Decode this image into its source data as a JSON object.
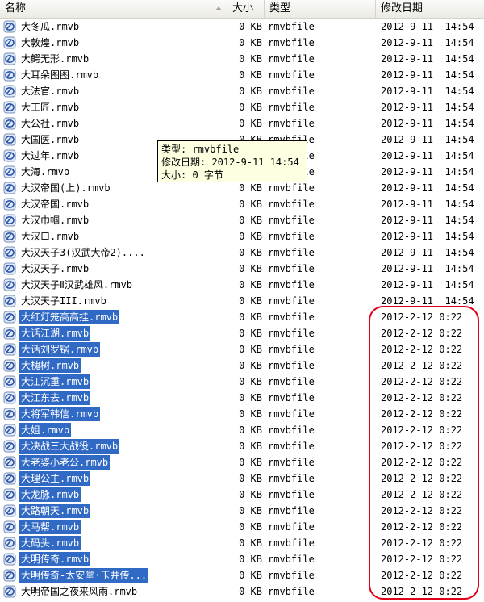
{
  "columns": {
    "name": "名称",
    "size": "大小",
    "type": "类型",
    "date": "修改日期"
  },
  "files": [
    {
      "name": "大冬瓜.rmvb",
      "size": "0 KB",
      "type": "rmvbfile",
      "date": "2012-9-11  14:54",
      "selected": false
    },
    {
      "name": "大敦煌.rmvb",
      "size": "0 KB",
      "type": "rmvbfile",
      "date": "2012-9-11  14:54",
      "selected": false
    },
    {
      "name": "大鳄无形.rmvb",
      "size": "0 KB",
      "type": "rmvbfile",
      "date": "2012-9-11  14:54",
      "selected": false
    },
    {
      "name": "大耳朵图图.rmvb",
      "size": "0 KB",
      "type": "rmvbfile",
      "date": "2012-9-11  14:54",
      "selected": false
    },
    {
      "name": "大法官.rmvb",
      "size": "0 KB",
      "type": "rmvbfile",
      "date": "2012-9-11  14:54",
      "selected": false
    },
    {
      "name": "大工匠.rmvb",
      "size": "0 KB",
      "type": "rmvbfile",
      "date": "2012-9-11  14:54",
      "selected": false
    },
    {
      "name": "大公社.rmvb",
      "size": "0 KB",
      "type": "rmvbfile",
      "date": "2012-9-11  14:54",
      "selected": false
    },
    {
      "name": "大国医.rmvb",
      "size": "0 KB",
      "type": "rmvbfile",
      "date": "2012-9-11  14:54",
      "selected": false
    },
    {
      "name": "大过年.rmvb",
      "size": "0 KB",
      "type": "rmvbfile",
      "date": "2012-9-11  14:54",
      "selected": false
    },
    {
      "name": "大海.rmvb",
      "size": "0 KB",
      "type": "rmvbfile",
      "date": "2012-9-11  14:54",
      "selected": false
    },
    {
      "name": "大汉帝国(上).rmvb",
      "size": "0 KB",
      "type": "rmvbfile",
      "date": "2012-9-11  14:54",
      "selected": false
    },
    {
      "name": "大汉帝国.rmvb",
      "size": "0 KB",
      "type": "rmvbfile",
      "date": "2012-9-11  14:54",
      "selected": false
    },
    {
      "name": "大汉巾帼.rmvb",
      "size": "0 KB",
      "type": "rmvbfile",
      "date": "2012-9-11  14:54",
      "selected": false
    },
    {
      "name": "大汉口.rmvb",
      "size": "0 KB",
      "type": "rmvbfile",
      "date": "2012-9-11  14:54",
      "selected": false
    },
    {
      "name": "大汉天子3(汉武大帝2)....",
      "size": "0 KB",
      "type": "rmvbfile",
      "date": "2012-9-11  14:54",
      "selected": false
    },
    {
      "name": "大汉天子.rmvb",
      "size": "0 KB",
      "type": "rmvbfile",
      "date": "2012-9-11  14:54",
      "selected": false
    },
    {
      "name": "大汉天子Ⅱ汉武雄风.rmvb",
      "size": "0 KB",
      "type": "rmvbfile",
      "date": "2012-9-11  14:54",
      "selected": false
    },
    {
      "name": "大汉天子III.rmvb",
      "size": "0 KB",
      "type": "rmvbfile",
      "date": "2012-9-11  14:54",
      "selected": false
    },
    {
      "name": "大红灯笼高高挂.rmvb",
      "size": "0 KB",
      "type": "rmvbfile",
      "date": "2012-2-12 0:22",
      "selected": true
    },
    {
      "name": "大话江湖.rmvb",
      "size": "0 KB",
      "type": "rmvbfile",
      "date": "2012-2-12 0:22",
      "selected": true
    },
    {
      "name": "大话刘罗锅.rmvb",
      "size": "0 KB",
      "type": "rmvbfile",
      "date": "2012-2-12 0:22",
      "selected": true
    },
    {
      "name": "大槐树.rmvb",
      "size": "0 KB",
      "type": "rmvbfile",
      "date": "2012-2-12 0:22",
      "selected": true
    },
    {
      "name": "大江沉重.rmvb",
      "size": "0 KB",
      "type": "rmvbfile",
      "date": "2012-2-12 0:22",
      "selected": true
    },
    {
      "name": "大江东去.rmvb",
      "size": "0 KB",
      "type": "rmvbfile",
      "date": "2012-2-12 0:22",
      "selected": true
    },
    {
      "name": "大将军韩信.rmvb",
      "size": "0 KB",
      "type": "rmvbfile",
      "date": "2012-2-12 0:22",
      "selected": true
    },
    {
      "name": "大姐.rmvb",
      "size": "0 KB",
      "type": "rmvbfile",
      "date": "2012-2-12 0:22",
      "selected": true
    },
    {
      "name": "大决战三大战役.rmvb",
      "size": "0 KB",
      "type": "rmvbfile",
      "date": "2012-2-12 0:22",
      "selected": true
    },
    {
      "name": "大老婆小老公.rmvb",
      "size": "0 KB",
      "type": "rmvbfile",
      "date": "2012-2-12 0:22",
      "selected": true
    },
    {
      "name": "大理公主.rmvb",
      "size": "0 KB",
      "type": "rmvbfile",
      "date": "2012-2-12 0:22",
      "selected": true
    },
    {
      "name": "大龙脉.rmvb",
      "size": "0 KB",
      "type": "rmvbfile",
      "date": "2012-2-12 0:22",
      "selected": true
    },
    {
      "name": "大路朝天.rmvb",
      "size": "0 KB",
      "type": "rmvbfile",
      "date": "2012-2-12 0:22",
      "selected": true
    },
    {
      "name": "大马帮.rmvb",
      "size": "0 KB",
      "type": "rmvbfile",
      "date": "2012-2-12 0:22",
      "selected": true
    },
    {
      "name": "大码头.rmvb",
      "size": "0 KB",
      "type": "rmvbfile",
      "date": "2012-2-12 0:22",
      "selected": true
    },
    {
      "name": "大明传奇.rmvb",
      "size": "0 KB",
      "type": "rmvbfile",
      "date": "2012-2-12 0:22",
      "selected": true
    },
    {
      "name": "大明传奇-太安堂·玉井传...",
      "size": "0 KB",
      "type": "rmvbfile",
      "date": "2012-2-12 0:22",
      "selected": true
    },
    {
      "name": "大明帝国之夜来风雨.rmvb",
      "size": "0 KB",
      "type": "rmvbfile",
      "date": "2012-2-12 0:22",
      "selected": false
    }
  ],
  "tooltip": {
    "type_line": "类型: rmvbfile",
    "date_line": "修改日期: 2012-9-11 14:54",
    "size_line": "大小: 0 字节"
  },
  "icon": "rmvb-file-icon",
  "colors": {
    "selection": "#316ac5",
    "highlight_circle": "#e0001a",
    "tooltip_bg": "#ffffe1"
  }
}
